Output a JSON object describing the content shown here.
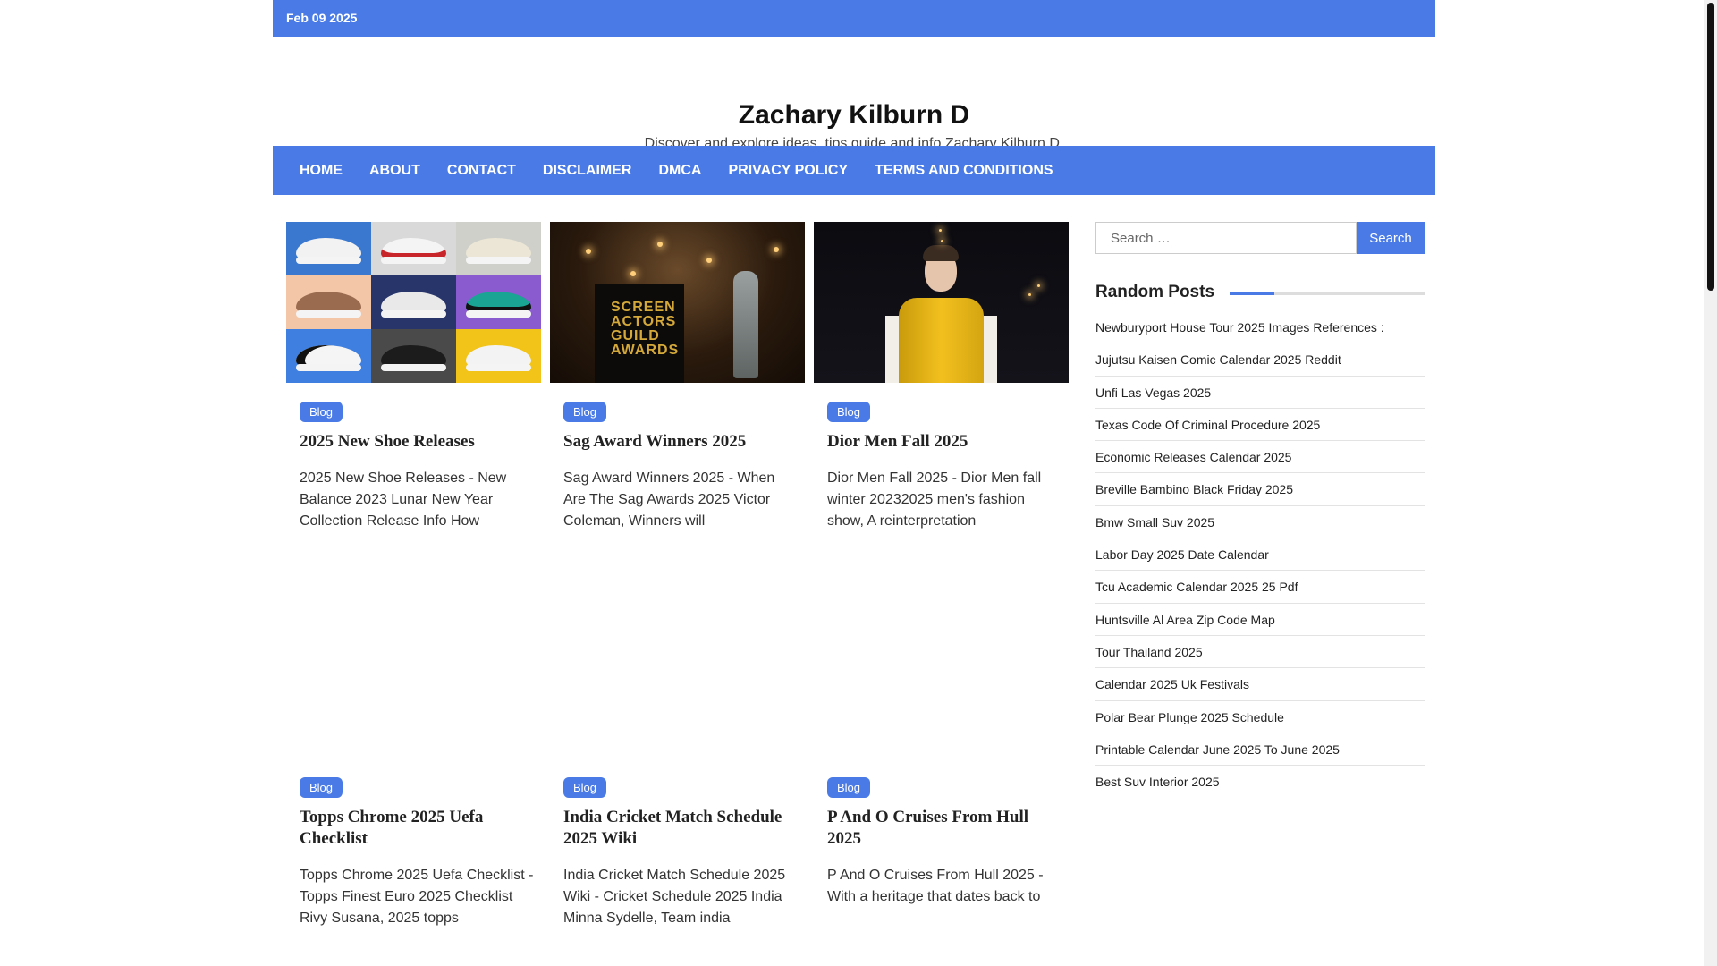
{
  "topbar": {
    "date": "Feb 09 2025"
  },
  "header": {
    "title": "Zachary Kilburn D",
    "description": "Discover and explore ideas, tips guide and info Zachary Kilburn D."
  },
  "nav": {
    "items": [
      "HOME",
      "ABOUT",
      "CONTACT",
      "DISCLAIMER",
      "DMCA",
      "PRIVACY POLICY",
      "TERMS AND CONDITIONS"
    ]
  },
  "cards": [
    {
      "badge": "Blog",
      "title": "2025 New Shoe Releases",
      "excerpt": "2025 New Shoe Releases - New Balance 2023 Lunar New Year Collection Release Info How"
    },
    {
      "badge": "Blog",
      "title": "Sag Award Winners 2025",
      "excerpt": "Sag Award Winners 2025 - When Are The Sag Awards 2025 Victor Coleman, Winners will",
      "image_text": "SCREEN ACTORS GUILD AWARDS"
    },
    {
      "badge": "Blog",
      "title": "Dior Men Fall 2025",
      "excerpt": "Dior Men Fall 2025 - Dior Men fall winter 20232025 men's fashion show, A reinterpretation"
    },
    {
      "badge": "Blog",
      "title": "Topps Chrome 2025 Uefa Checklist",
      "excerpt": "Topps Chrome 2025 Uefa Checklist - Topps Finest Euro 2025 Checklist Rivy Susana, 2025 topps"
    },
    {
      "badge": "Blog",
      "title": "India Cricket Match Schedule 2025 Wiki",
      "excerpt": "India Cricket Match Schedule 2025 Wiki - Cricket Schedule 2025 India Minna Sydelle, Team india"
    },
    {
      "badge": "Blog",
      "title": "P And O Cruises From Hull 2025",
      "excerpt": "P And O Cruises From Hull 2025 - With a heritage that dates back to"
    }
  ],
  "sidebar": {
    "search": {
      "placeholder": "Search …",
      "button": "Search"
    },
    "random_posts": {
      "title": "Random Posts",
      "items": [
        "Newburyport House Tour 2025 Images References :",
        "Jujutsu Kaisen Comic Calendar 2025 Reddit",
        "Unfi Las Vegas 2025",
        "Texas Code Of Criminal Procedure 2025",
        "Economic Releases Calendar 2025",
        "Breville Bambino Black Friday 2025",
        "Bmw Small Suv 2025",
        "Labor Day 2025 Date Calendar",
        "Tcu Academic Calendar 2025 25 Pdf",
        "Huntsville Al Area Zip Code Map",
        "Tour Thailand 2025",
        "Calendar 2025 Uk Festivals",
        "Polar Bear Plunge 2025 Schedule",
        "Printable Calendar June 2025 To June 2025",
        "Best Suv Interior 2025"
      ]
    }
  },
  "colors": {
    "accent": "#4a7ae5",
    "text": "#222222"
  }
}
